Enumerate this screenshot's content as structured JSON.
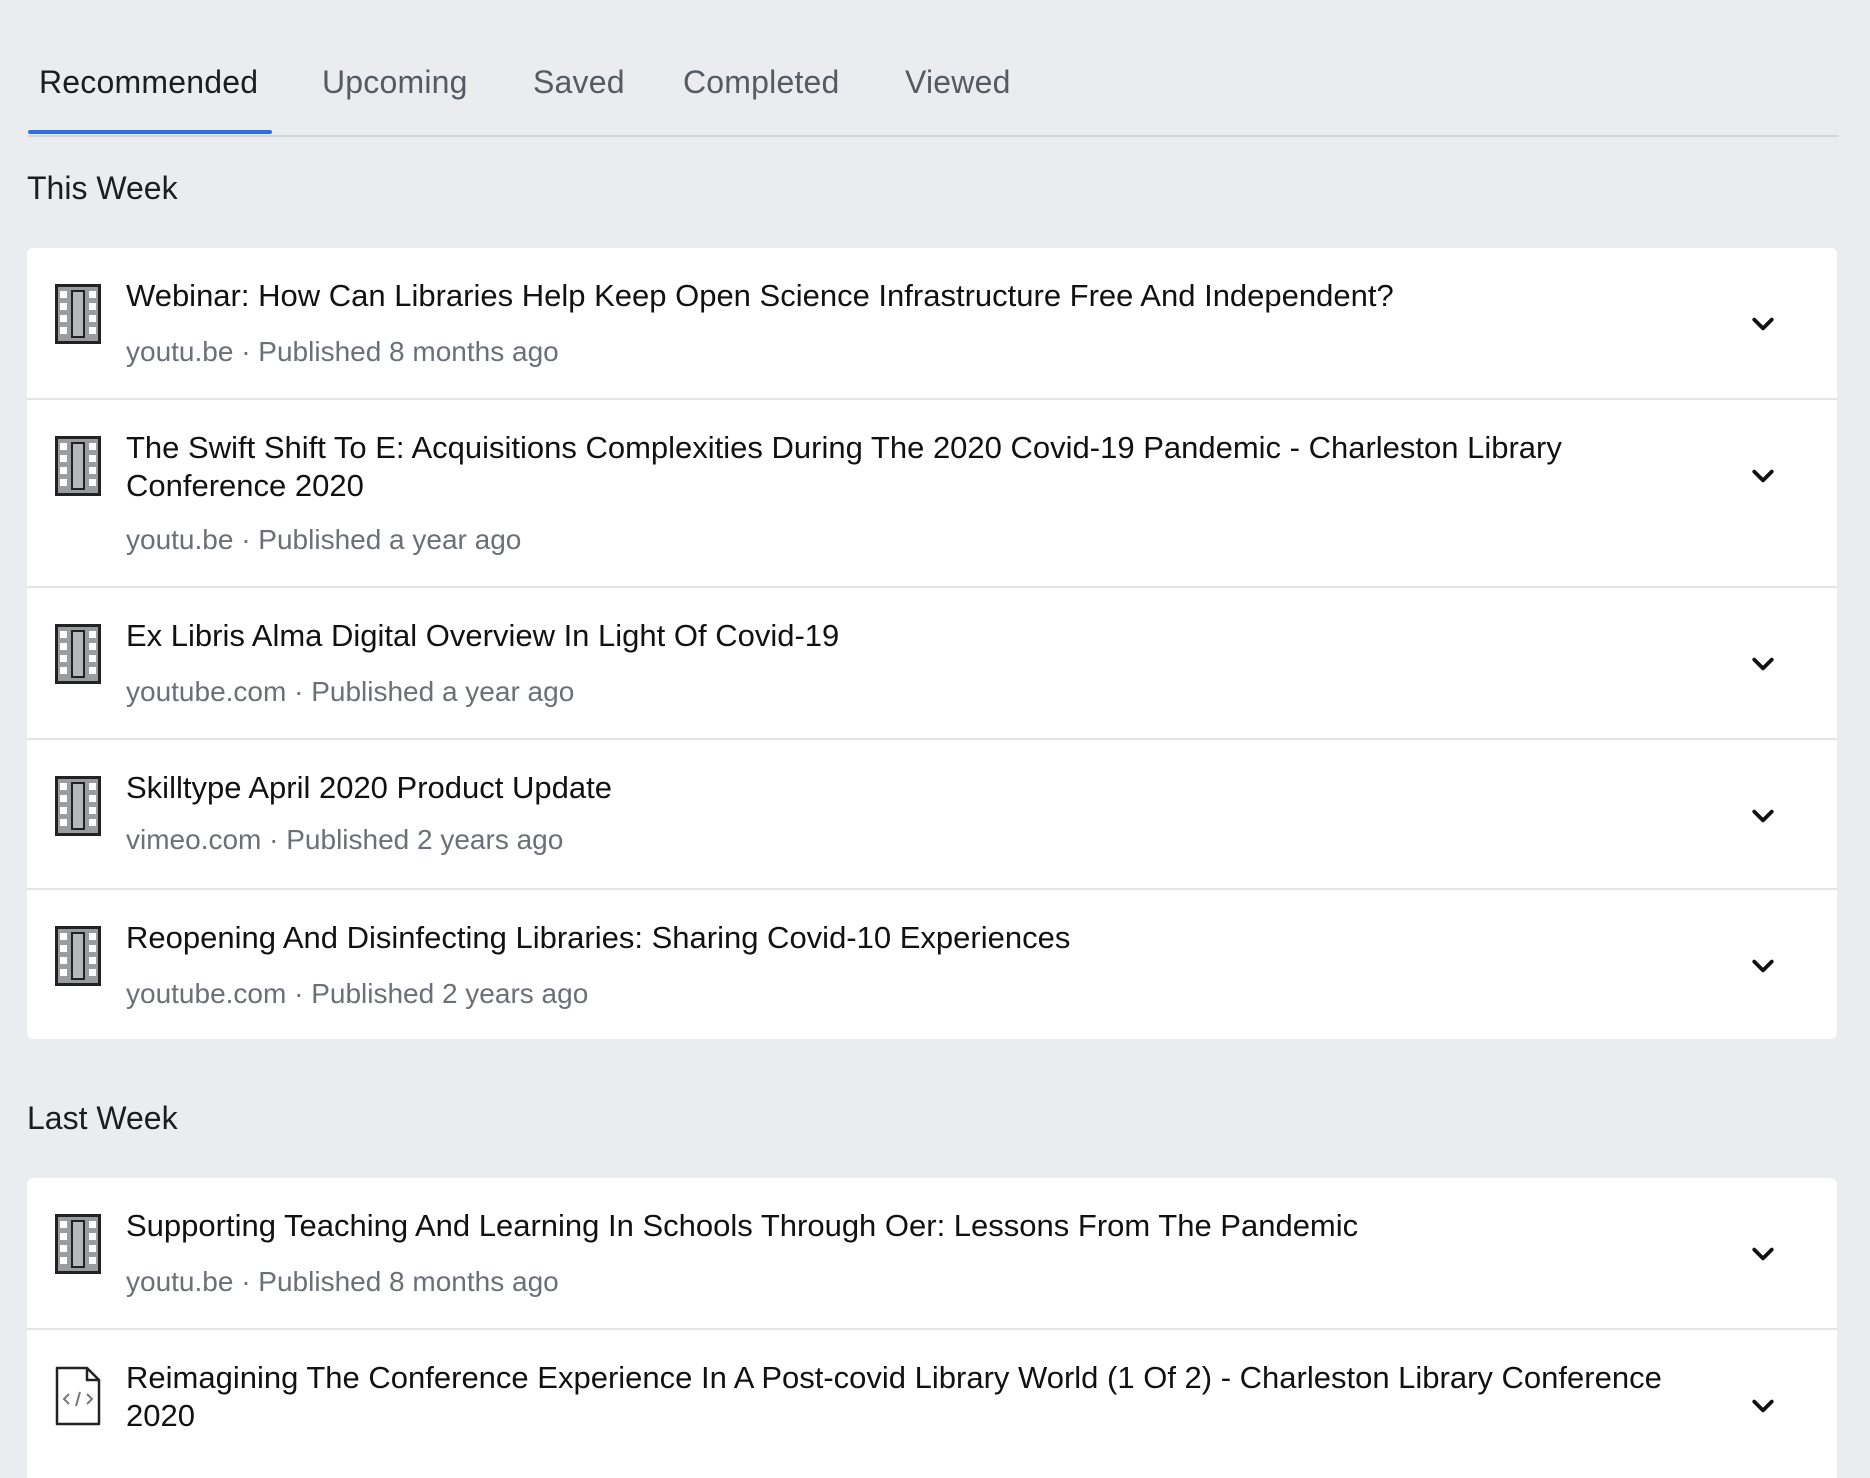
{
  "tabs": [
    {
      "label": "Recommended",
      "active": true
    },
    {
      "label": "Upcoming",
      "active": false
    },
    {
      "label": "Saved",
      "active": false
    },
    {
      "label": "Completed",
      "active": false
    },
    {
      "label": "Viewed",
      "active": false
    }
  ],
  "sections": [
    {
      "title": "This Week",
      "items": [
        {
          "icon": "film-icon",
          "title": "Webinar: How Can Libraries Help Keep Open Science Infrastructure Free And Independent?",
          "source": "youtu.be",
          "published": "Published 8 months ago",
          "meta": "youtu.be · Published 8 months ago"
        },
        {
          "icon": "film-icon",
          "title": "The Swift Shift To E: Acquisitions Complexities During The 2020 Covid-19 Pandemic - Charleston Library Conference 2020",
          "source": "youtu.be",
          "published": "Published a year ago",
          "meta": "youtu.be · Published a year ago"
        },
        {
          "icon": "film-icon",
          "title": "Ex Libris Alma Digital Overview In Light Of Covid-19",
          "source": "youtube.com",
          "published": "Published a year ago",
          "meta": "youtube.com · Published a year ago"
        },
        {
          "icon": "film-icon",
          "title": "Skilltype April 2020 Product Update",
          "source": "vimeo.com",
          "published": "Published 2 years ago",
          "meta": "vimeo.com · Published 2 years ago"
        },
        {
          "icon": "film-icon",
          "title": "Reopening And Disinfecting Libraries: Sharing Covid-10 Experiences",
          "source": "youtube.com",
          "published": "Published 2 years ago",
          "meta": "youtube.com · Published 2 years ago"
        }
      ]
    },
    {
      "title": "Last Week",
      "items": [
        {
          "icon": "film-icon",
          "title": "Supporting Teaching And Learning In Schools Through Oer: Lessons From The Pandemic",
          "source": "youtu.be",
          "published": "Published 8 months ago",
          "meta": "youtu.be · Published 8 months ago"
        },
        {
          "icon": "code-file-icon",
          "title": "Reimagining The Conference Experience In A Post-covid Library World (1 Of 2) - Charleston Library Conference 2020",
          "source": "",
          "published": "",
          "meta": ""
        }
      ]
    }
  ],
  "colors": {
    "background": "#ebecf0",
    "accent": "#2f6fe4",
    "card": "#ffffff",
    "meta_text": "#6b6f76"
  }
}
